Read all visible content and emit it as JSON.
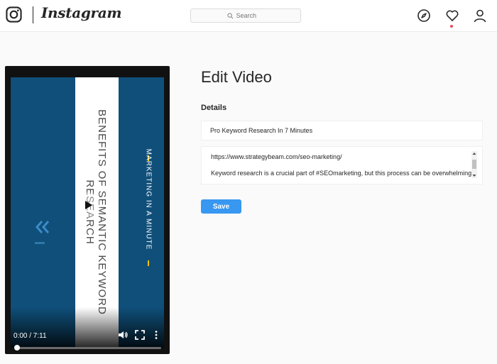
{
  "app": {
    "name": "Instagram",
    "brand_color": "#262626",
    "accent_color": "#3897f0",
    "notification_color": "#ed4956"
  },
  "header": {
    "logo_icon": "instagram-glyph",
    "search": {
      "placeholder": "Search",
      "icon": "search-icon"
    },
    "nav_icons": [
      "explore-compass-icon",
      "activity-heart-icon",
      "profile-icon"
    ]
  },
  "video": {
    "title_overlay": "BENEFITS OF SEMANTIC KEYWORD RESEARCH",
    "side_text": "MARKETING IN A MINUTE",
    "current_time": "0:00",
    "duration": "7:11",
    "time_display": "0:00 / 7:11",
    "progress_fraction": 0,
    "background_color": "#0f4f7a",
    "controls": [
      "play-icon",
      "volume-icon",
      "fullscreen-icon",
      "more-options-icon"
    ]
  },
  "edit": {
    "page_title": "Edit Video",
    "section_label": "Details",
    "title_value": "Pro Keyword Research In 7 Minutes",
    "description_lines": [
      "https://www.strategybeam.com/seo-marketing/",
      "Keyword research is a crucial part of #SEOmarketing, but this process can be overwhelming"
    ],
    "save_label": "Save"
  }
}
